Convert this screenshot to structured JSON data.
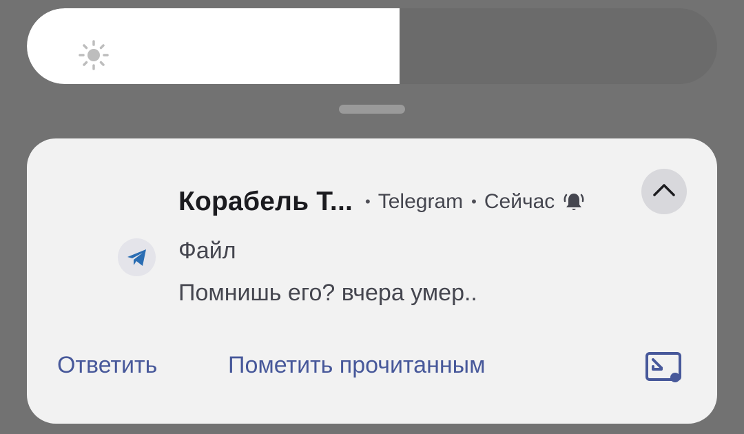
{
  "brightness": {
    "level": 0.54,
    "icon": "sun-icon"
  },
  "notification": {
    "sender": "Корабель Т...",
    "separator": "•",
    "app_name": "Telegram",
    "time": "Сейчас",
    "title": "Файл",
    "message": "Помнишь его? вчера умер..",
    "app_icon": "telegram-icon",
    "bell_icon": "bell-alert-icon",
    "expand_icon": "chevron-up-icon",
    "actions": {
      "reply": "Ответить",
      "mark_read": "Пометить прочитанным"
    },
    "pip_icon": "picture-in-picture-icon"
  },
  "colors": {
    "background": "#727272",
    "card": "#f2f2f2",
    "accent": "#47589a",
    "telegram_blue": "#2a6db3"
  }
}
